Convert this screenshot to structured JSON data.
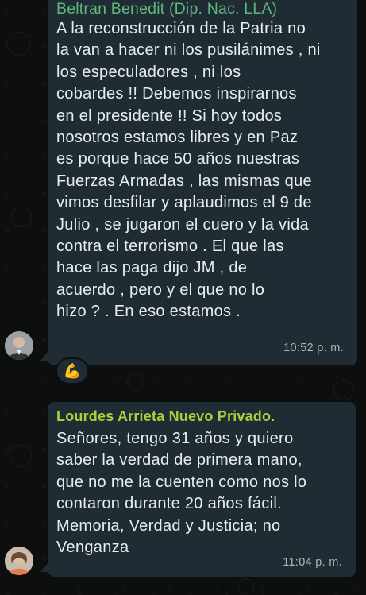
{
  "messages": [
    {
      "sender": "Beltran Benedit (Dip. Nac. LLA)",
      "sender_color": "#5db77f",
      "lines": [
        "A la reconstrucción de la Patria no",
        "la van a hacer ni los pusilánimes , ni",
        "los especuladores , ni los",
        "cobardes !! Debemos inspirarnos",
        "en el presidente !! Si hoy todos",
        "nosotros estamos libres y en Paz",
        "es porque hace 50 años nuestras",
        "Fuerzas Armadas , las mismas que",
        "vimos desfilar y aplaudimos el 9 de",
        "Julio , se jugaron el cuero y la vida",
        "contra el terrorismo  . El que las",
        "hace las paga dijo JM , de",
        "acuerdo , pero y el que no lo",
        "hizo ? . En eso estamos ."
      ],
      "time": "10:52 p. m.",
      "reaction": "💪"
    },
    {
      "sender": "Lourdes Arrieta Nuevo Privado.",
      "sender_color": "#a9cf3f",
      "lines": [
        "Señores, tengo 31 años y quiero",
        "saber la verdad de primera mano,",
        "que no me la cuenten como nos lo",
        "contaron durante 20 años fácil.",
        "Memoria, Verdad y Justicia; no",
        "Venganza"
      ],
      "time": "11:04 p. m."
    }
  ],
  "colors": {
    "bubble": "#202c33",
    "text": "#e9edef",
    "timestamp": "#aab4ba",
    "background": "#0c0f0e"
  },
  "icons": {
    "reaction": "flexed-biceps-icon",
    "avatar1": "avatar",
    "avatar2": "avatar"
  }
}
